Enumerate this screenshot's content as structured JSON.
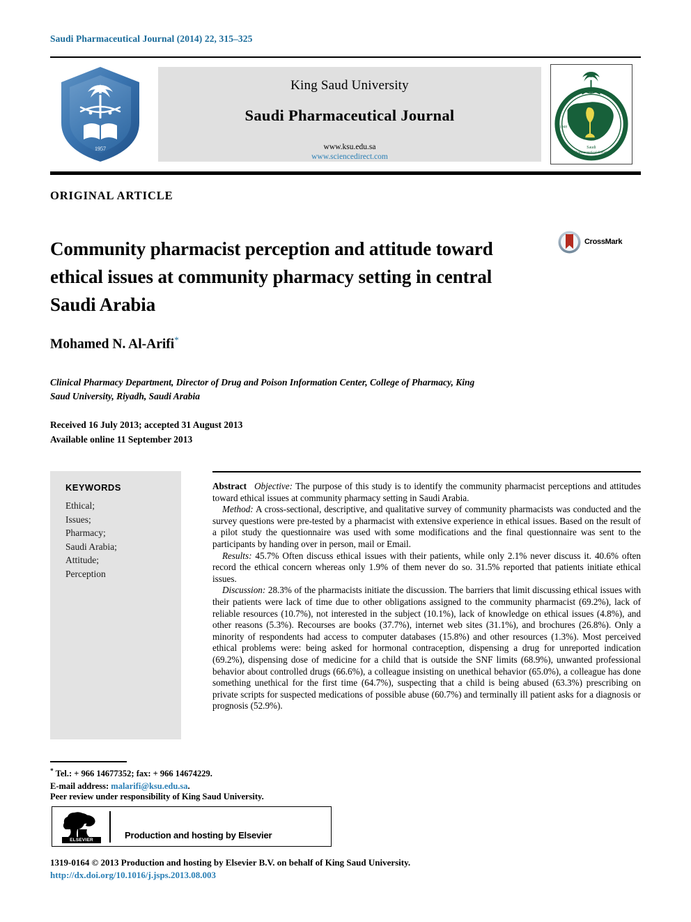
{
  "running_head": "Saudi Pharmaceutical Journal (2014) 22, 315–325",
  "banner": {
    "university": "King Saud University",
    "journal": "Saudi Pharmaceutical Journal",
    "url_primary": "www.ksu.edu.sa",
    "url_secondary": "www.sciencedirect.com",
    "left_logo_name": "king-saud-university-seal",
    "left_logo_year": "1957",
    "right_logo_name": "saudi-pharmaceutical-society-seal",
    "right_logo_year": "1948"
  },
  "article_type": "ORIGINAL ARTICLE",
  "title": "Community pharmacist perception and attitude toward ethical issues at community pharmacy setting in central Saudi Arabia",
  "crossmark": {
    "label": "CrossMark",
    "ring_color": "#8fa7bd",
    "ribbon_color": "#b42b1f"
  },
  "author": {
    "name": "Mohamed N. Al-Arifi",
    "corresponding_marker": "*"
  },
  "affiliation": "Clinical Pharmacy Department, Director of Drug and Poison Information Center, College of Pharmacy, King Saud University, Riyadh, Saudi Arabia",
  "history": {
    "received_accepted": "Received 16 July 2013; accepted 31 August 2013",
    "available_online": "Available online 11 September 2013"
  },
  "keywords": {
    "heading": "KEYWORDS",
    "items": [
      "Ethical;",
      "Issues;",
      "Pharmacy;",
      "Saudi Arabia;",
      "Attitude;",
      "Perception"
    ]
  },
  "abstract": {
    "heading": "Abstract",
    "sections": [
      {
        "label": "Objective:",
        "text": "The purpose of this study is to identify the community pharmacist perceptions and attitudes toward ethical issues at community pharmacy setting in Saudi Arabia."
      },
      {
        "label": "Method:",
        "text": "A cross-sectional, descriptive, and qualitative survey of community pharmacists was conducted and the survey questions were pre-tested by a pharmacist with extensive experience in ethical issues. Based on the result of a pilot study the questionnaire was used with some modifications and the final questionnaire was sent to the participants by handing over in person, mail or Email."
      },
      {
        "label": "Results:",
        "text": "45.7% Often discuss ethical issues with their patients, while only 2.1% never discuss it. 40.6% often record the ethical concern whereas only 1.9% of them never do so. 31.5% reported that patients initiate ethical issues."
      },
      {
        "label": "Discussion:",
        "text": "28.3% of the pharmacists initiate the discussion. The barriers that limit discussing ethical issues with their patients were lack of time due to other obligations assigned to the community pharmacist (69.2%), lack of reliable resources (10.7%), not interested in the subject (10.1%), lack of knowledge on ethical issues (4.8%), and other reasons (5.3%). Recourses are books (37.7%), internet web sites (31.1%), and brochures (26.8%). Only a minority of respondents had access to computer databases (15.8%) and other resources (1.3%). Most perceived ethical problems were: being asked for hormonal contraception, dispensing a drug for unreported indication (69.2%), dispensing dose of medicine for a child that is outside the SNF limits (68.9%), unwanted professional behavior about controlled drugs (66.6%), a colleague insisting on unethical behavior (65.0%), a colleague has done something unethical for the first time (64.7%), suspecting that a child is being abused (63.3%) prescribing on private scripts for suspected medications of possible abuse (60.7%) and terminally ill patient asks for a diagnosis or prognosis (52.9%)."
      }
    ]
  },
  "footnotes": {
    "marker": "*",
    "tel_fax": "Tel.: + 966 14677352; fax: + 966 14674229.",
    "email_label": "E-mail address:",
    "email": "malarifi@ksu.edu.sa",
    "email_trailing": ".",
    "peer_review": "Peer review under responsibility of King Saud University."
  },
  "elsevier": {
    "wordmark": "ELSEVIER",
    "text": "Production and hosting by Elsevier"
  },
  "colophon": {
    "line": "1319-0164 © 2013 Production and hosting by Elsevier B.V. on behalf of King Saud University.",
    "doi": "http://dx.doi.org/10.1016/j.jsps.2013.08.003"
  },
  "colors": {
    "link": "#2a7fb5",
    "running_head": "#1a6b9a",
    "banner_bg": "#e0e0e0",
    "keyword_bg": "#e3e3e3",
    "ksu_blue": "#2f6ca8",
    "sps_green": "#17603a"
  }
}
